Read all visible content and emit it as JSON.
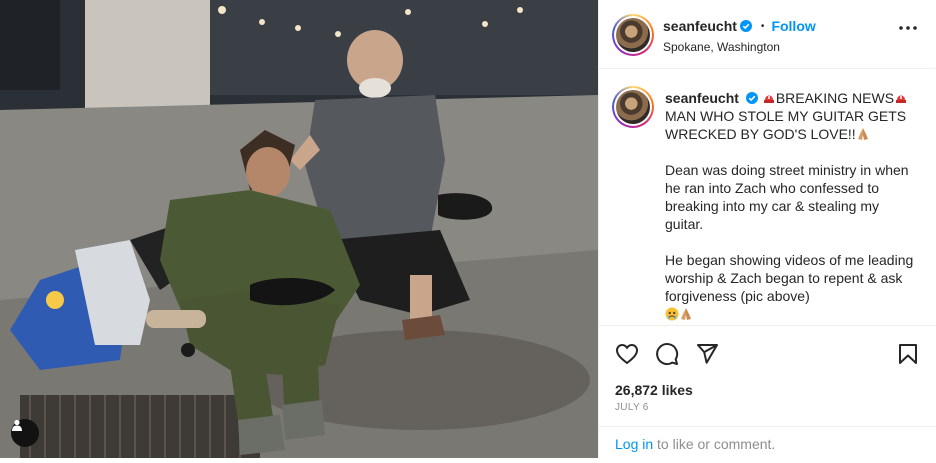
{
  "post": {
    "username": "seanfeucht",
    "follow_label": "Follow",
    "separator": "•",
    "location": "Spokane, Washington",
    "caption": {
      "username": "seanfeucht",
      "line1": "BREAKING NEWS",
      "line1_rest": "MAN WHO STOLE MY GUITAR GETS WRECKED BY GOD'S LOVE!!",
      "para2": "Dean was doing street ministry in when he ran into Zach who confessed to breaking into my car & stealing my guitar.",
      "para3": "He began showing videos of me leading worship & Zach began to repent & ask forgiveness (pic above)"
    },
    "likes": "26,872 likes",
    "date": "JULY 6",
    "login_link": "Log in",
    "login_rest": " to like or comment."
  },
  "icons": {
    "more": "more-options-icon",
    "like": "heart-icon",
    "comment": "comment-icon",
    "share": "share-icon",
    "save": "bookmark-icon",
    "tag": "user-tag-icon",
    "verified": "verified-badge-icon",
    "siren": "siren-emoji",
    "pray": "praying-hands-emoji",
    "cry": "crying-face-emoji"
  },
  "colors": {
    "accent": "#0095f6",
    "text": "#262626",
    "muted": "#8e8e8e",
    "border": "#efefef"
  }
}
